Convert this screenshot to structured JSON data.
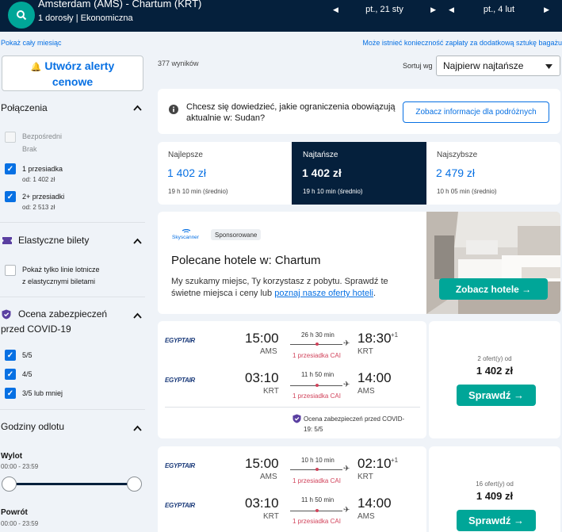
{
  "header": {
    "route": "Amsterdam (AMS) - Chartum (KRT)",
    "passengers": "1 dorosły | Ekonomiczna",
    "depart_date": "pt., 21 sty",
    "return_date": "pt., 4 lut"
  },
  "links": {
    "month": "Pokaż cały miesiąc",
    "baggage": "Może istnieć konieczność zapłaty za dodatkową sztukę bagażu"
  },
  "sidebar": {
    "alert_button": "Utwórz alerty cenowe",
    "connections_title": "Połączenia",
    "direct_label": "Bezpośredni",
    "direct_sub": "Brak",
    "one_stop_label": "1 przesiadka",
    "one_stop_sub": "od: 1 402 zł",
    "two_stop_label": "2+ przesiadki",
    "two_stop_sub": "od: 2 513 zł",
    "flex_title": "Elastyczne bilety",
    "flex_option_line1": "Pokaż tylko linie lotnicze",
    "flex_option_line2": "z elastycznymi biletami",
    "covid_title_line1": "Ocena zabezpieczeń",
    "covid_title_line2": "przed COVID-19",
    "covid_5": "5/5",
    "covid_4": "4/5",
    "covid_3": "3/5 lub mniej",
    "departure_title": "Godziny odlotu",
    "outbound_label": "Wylot",
    "outbound_range": "00:00 - 23:59",
    "return_label": "Powrót",
    "return_range": "00:00 - 23:59"
  },
  "results": {
    "count": "377 wyników",
    "sort_label": "Sortuj wg",
    "sort_value": "Najpierw najtańsze"
  },
  "info": {
    "text_line1": "Chcesz się dowiedzieć, jakie ograniczenia obowiązują",
    "text_line2": "aktualnie w: Sudan?",
    "button": "Zobacz informacje dla podróżnych"
  },
  "tabs": [
    {
      "title": "Najlepsze",
      "price": "1 402 zł",
      "duration": "19 h 10 min (średnio)"
    },
    {
      "title": "Najtańsze",
      "price": "1 402 zł",
      "duration": "19 h 10 min (średnio)"
    },
    {
      "title": "Najszybsze",
      "price": "2 479 zł",
      "duration": "10 h 05 min (średnio)"
    }
  ],
  "ad": {
    "brand": "Skyscanner",
    "badge": "Sponsorowane",
    "title": "Polecane hotele w: Chartum",
    "text_line1": "My szukamy miejsc, Ty korzystasz z pobytu. Sprawdź te",
    "text_line2_plain": "świetne miejsca i ceny lub ",
    "text_line2_link": "poznaj nasze oferty hoteli",
    "text_line2_end": ".",
    "cta": "Zobacz hotele →"
  },
  "flights": [
    {
      "outbound": {
        "airline": "EGYPTAIR",
        "dep": "15:00",
        "dep_code": "AMS",
        "dur": "26 h 30 min",
        "stop": "1 przesiadka CAI",
        "arr": "18:30",
        "plus": "+1",
        "arr_code": "KRT"
      },
      "inbound": {
        "airline": "EGYPTAIR",
        "dep": "03:10",
        "dep_code": "KRT",
        "dur": "11 h 50 min",
        "stop": "1 przesiadka CAI",
        "arr": "14:00",
        "plus": "",
        "arr_code": "AMS"
      },
      "covid_line1": "Ocena zabezpieczeń przed COVID-",
      "covid_line2": "19: 5/5",
      "offers": "2 ofert(y) od",
      "price": "1 402 zł",
      "button": "Sprawdź →"
    },
    {
      "outbound": {
        "airline": "EGYPTAIR",
        "dep": "15:00",
        "dep_code": "AMS",
        "dur": "10 h 10 min",
        "stop": "1 przesiadka CAI",
        "arr": "02:10",
        "plus": "+1",
        "arr_code": "KRT"
      },
      "inbound": {
        "airline": "EGYPTAIR",
        "dep": "03:10",
        "dep_code": "KRT",
        "dur": "11 h 50 min",
        "stop": "1 przesiadka CAI",
        "arr": "14:00",
        "plus": "",
        "arr_code": "AMS"
      },
      "offers": "16 ofert(y) od",
      "price": "1 409 zł",
      "button": "Sprawdź →"
    }
  ],
  "colors": {
    "navy": "#05203c",
    "teal": "#00a698",
    "blue": "#0770e3",
    "red": "#d1435b"
  },
  "icons": [
    "search-icon",
    "bell-icon",
    "ticket-icon",
    "shield-icon",
    "info-icon",
    "plane-icon",
    "chevron-up-icon",
    "chevron-down-icon",
    "check-icon"
  ]
}
